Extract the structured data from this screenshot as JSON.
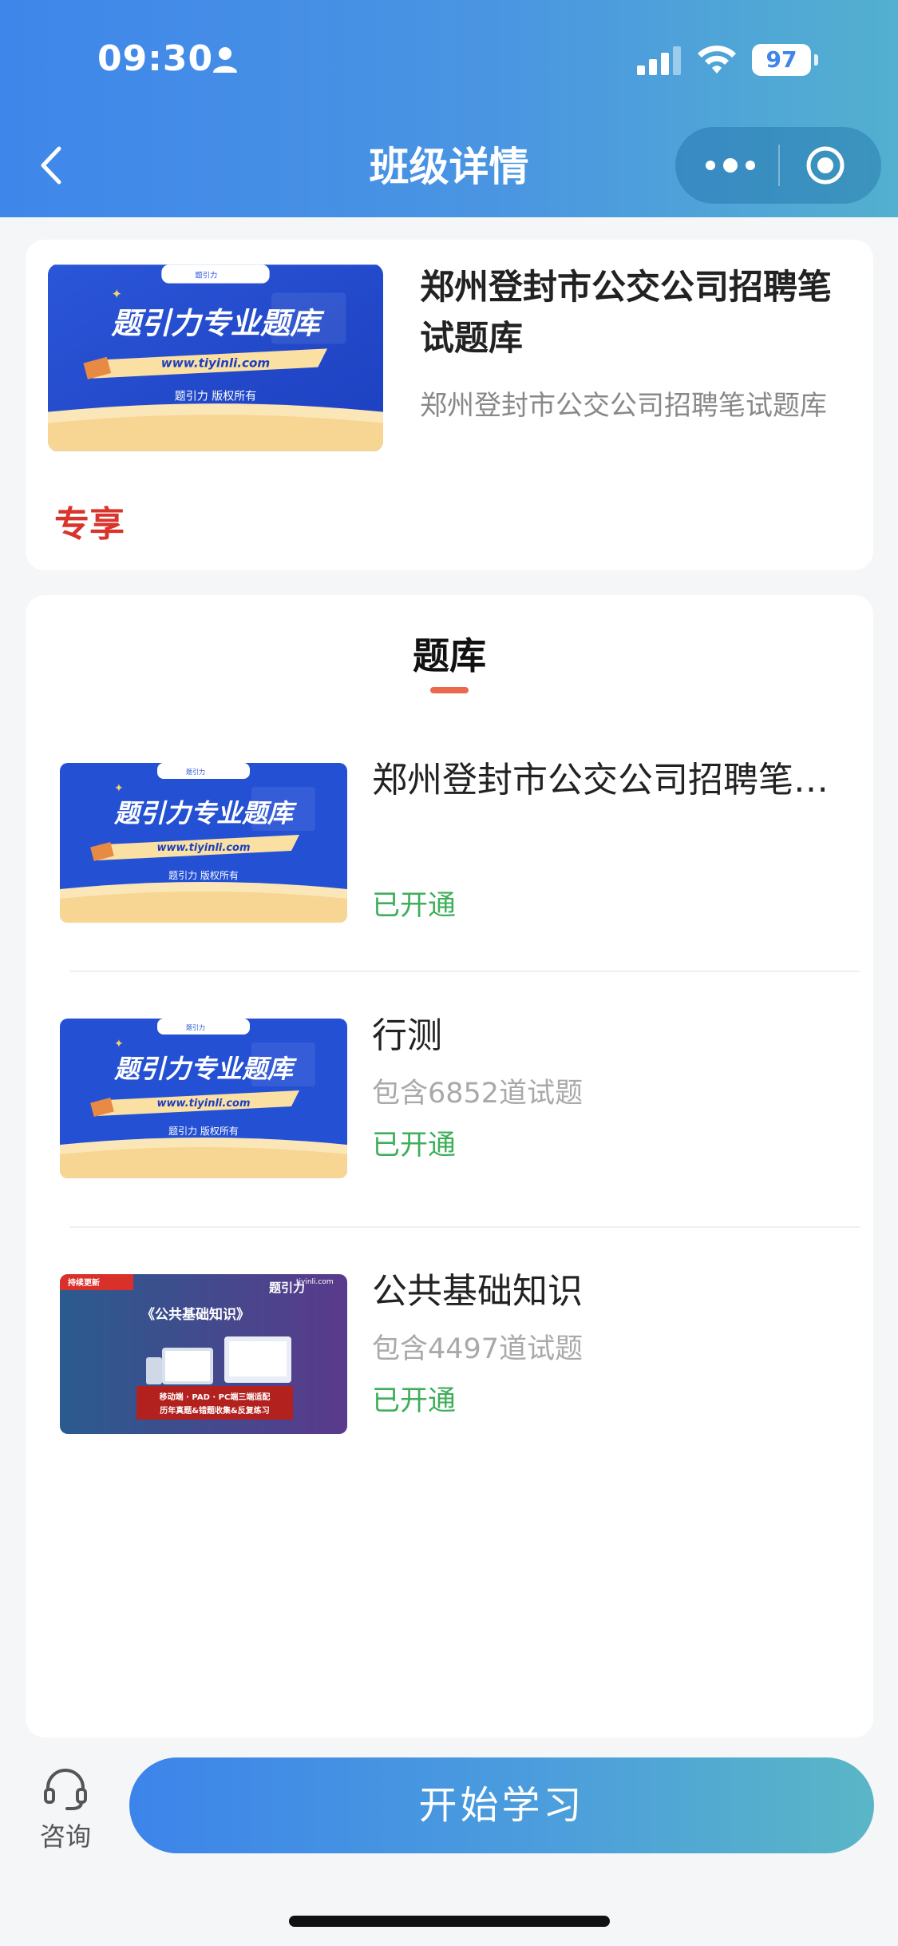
{
  "status_bar": {
    "time": "09:30",
    "battery": "97"
  },
  "nav": {
    "title": "班级详情"
  },
  "course": {
    "title": "郑州登封市公交公司招聘笔试题库",
    "subtitle": "郑州登封市公交公司招聘笔试题库",
    "tag": "专享",
    "cover": {
      "small_label": "题引力",
      "headline": "题引力专业题库",
      "url": "www.tiyinli.com",
      "footer": "题引力 版权所有"
    }
  },
  "bank_section": {
    "title": "题库",
    "items": [
      {
        "name": "郑州登封市公交公司招聘笔试题库",
        "count": "",
        "status": "已开通",
        "cover": "brand"
      },
      {
        "name": "行测",
        "count": "包含6852道试题",
        "status": "已开通",
        "cover": "brand"
      },
      {
        "name": "公共基础知识",
        "count": "包含4497道试题",
        "status": "已开通",
        "cover": "gongji"
      }
    ]
  },
  "gongji_cover": {
    "ribbon": "持续更新",
    "logo_top": "题引力",
    "site": "tiyinli.com",
    "title": "《公共基础知识》",
    "line1": "移动端 · PAD · PC端三端适配",
    "line2": "历年真题&错题收集&反复练习"
  },
  "bottom": {
    "consult_label": "咨询",
    "start_label": "开始学习"
  },
  "colors": {
    "accent_blue": "#3f86ea",
    "accent_teal": "#5ab6c6",
    "exclusive_red": "#d8342b",
    "status_green": "#3fae5a",
    "underline_orange": "#e9694e"
  },
  "icons": [
    "back-icon",
    "person-icon",
    "signal-icon",
    "wifi-icon",
    "more-icon",
    "target-icon",
    "headset-icon"
  ]
}
